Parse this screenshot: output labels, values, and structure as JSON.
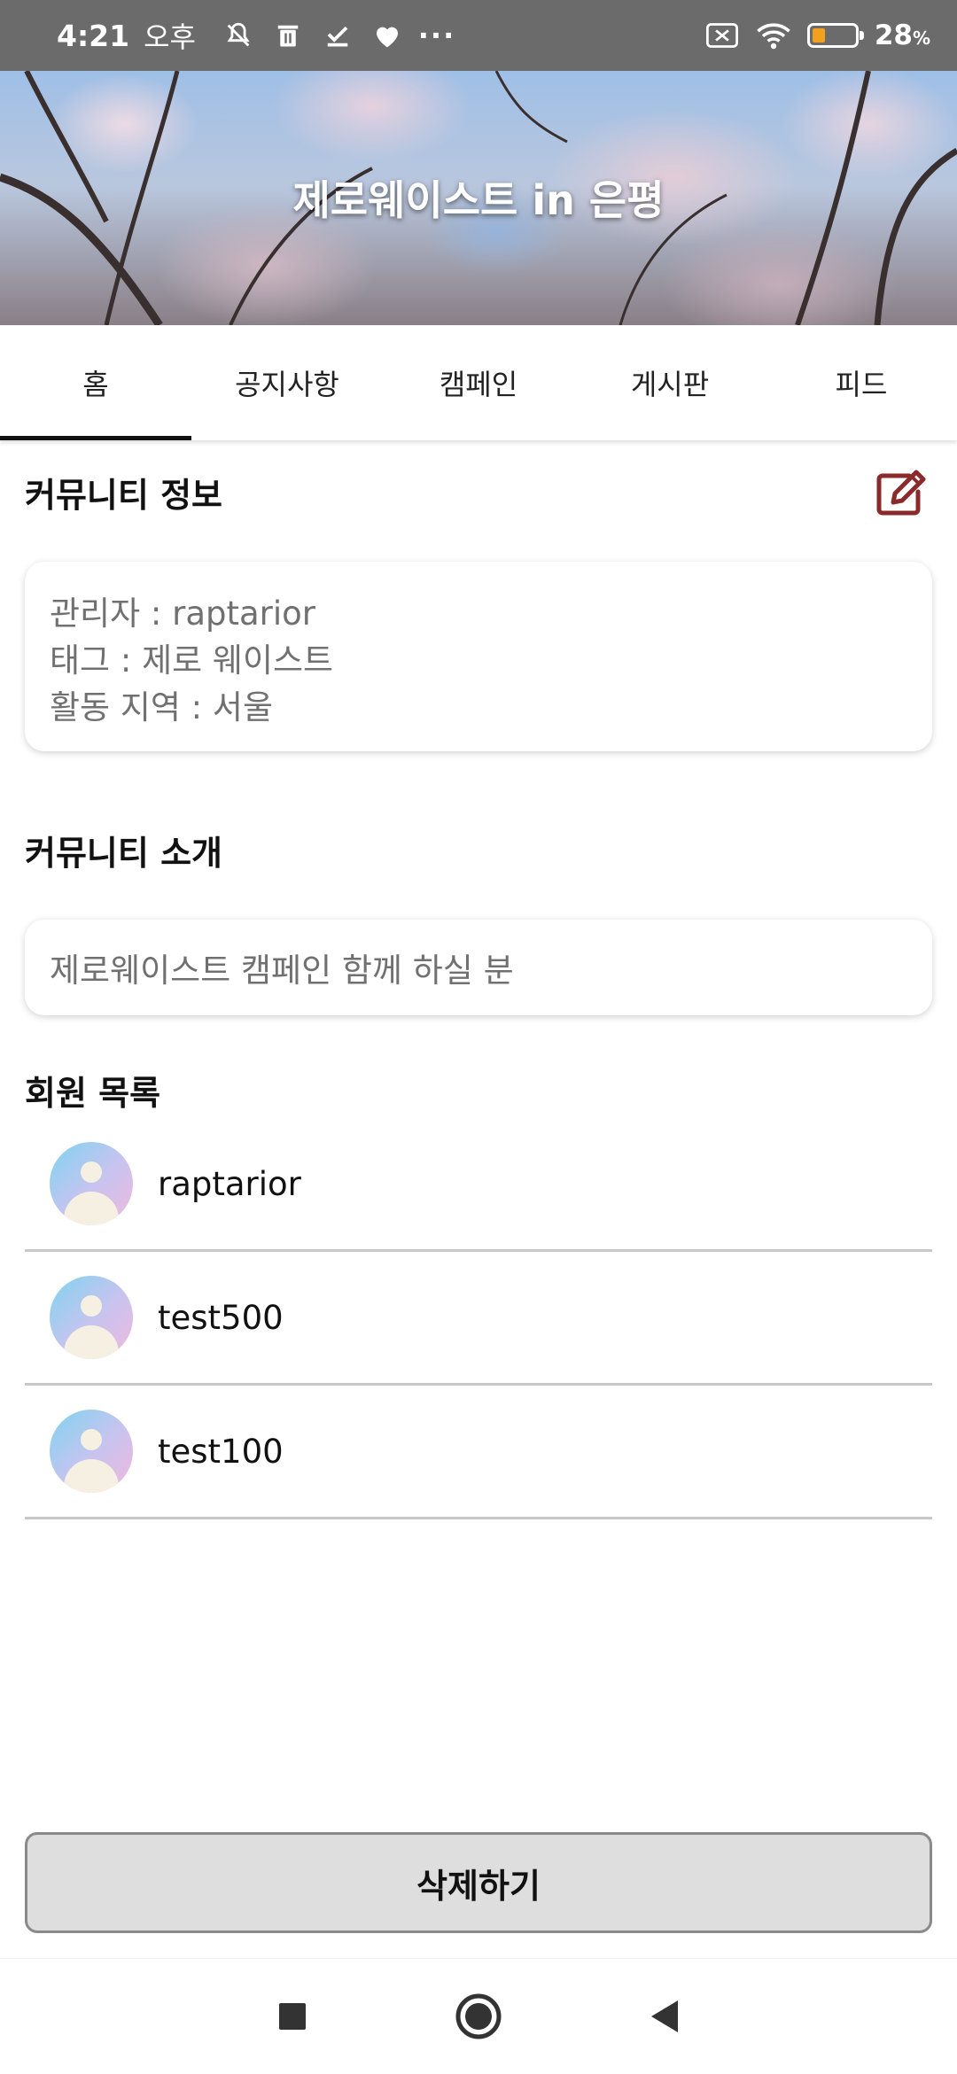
{
  "status_bar": {
    "time": "4:21",
    "ampm": "오후",
    "battery_percent": "28",
    "battery_unit": "%",
    "icons": [
      "mute-icon",
      "trash-icon",
      "check-icon",
      "heart-icon",
      "more-icon",
      "sim-icon",
      "wifi-icon",
      "battery-icon"
    ],
    "more_label": "···"
  },
  "header": {
    "title": "제로웨이스트 in 은평"
  },
  "tabs": [
    {
      "label": "홈",
      "active": true
    },
    {
      "label": "공지사항",
      "active": false
    },
    {
      "label": "캠페인",
      "active": false
    },
    {
      "label": "게시판",
      "active": false
    },
    {
      "label": "피드",
      "active": false
    }
  ],
  "community_info": {
    "title": "커뮤니티 정보",
    "lines": [
      "관리자 : raptarior",
      "태그 : 제로 웨이스트",
      "활동 지역 : 서울"
    ]
  },
  "community_intro": {
    "title": "커뮤니티 소개",
    "text": "제로웨이스트 캠페인 함께 하실 분"
  },
  "members": {
    "title": "회원 목록",
    "items": [
      {
        "name": "raptarior"
      },
      {
        "name": "test500"
      },
      {
        "name": "test100"
      }
    ]
  },
  "actions": {
    "delete_label": "삭제하기"
  },
  "colors": {
    "accent": "#8b2a2a",
    "status_bar": "#6b6b6b",
    "button_bg": "#dedede"
  }
}
